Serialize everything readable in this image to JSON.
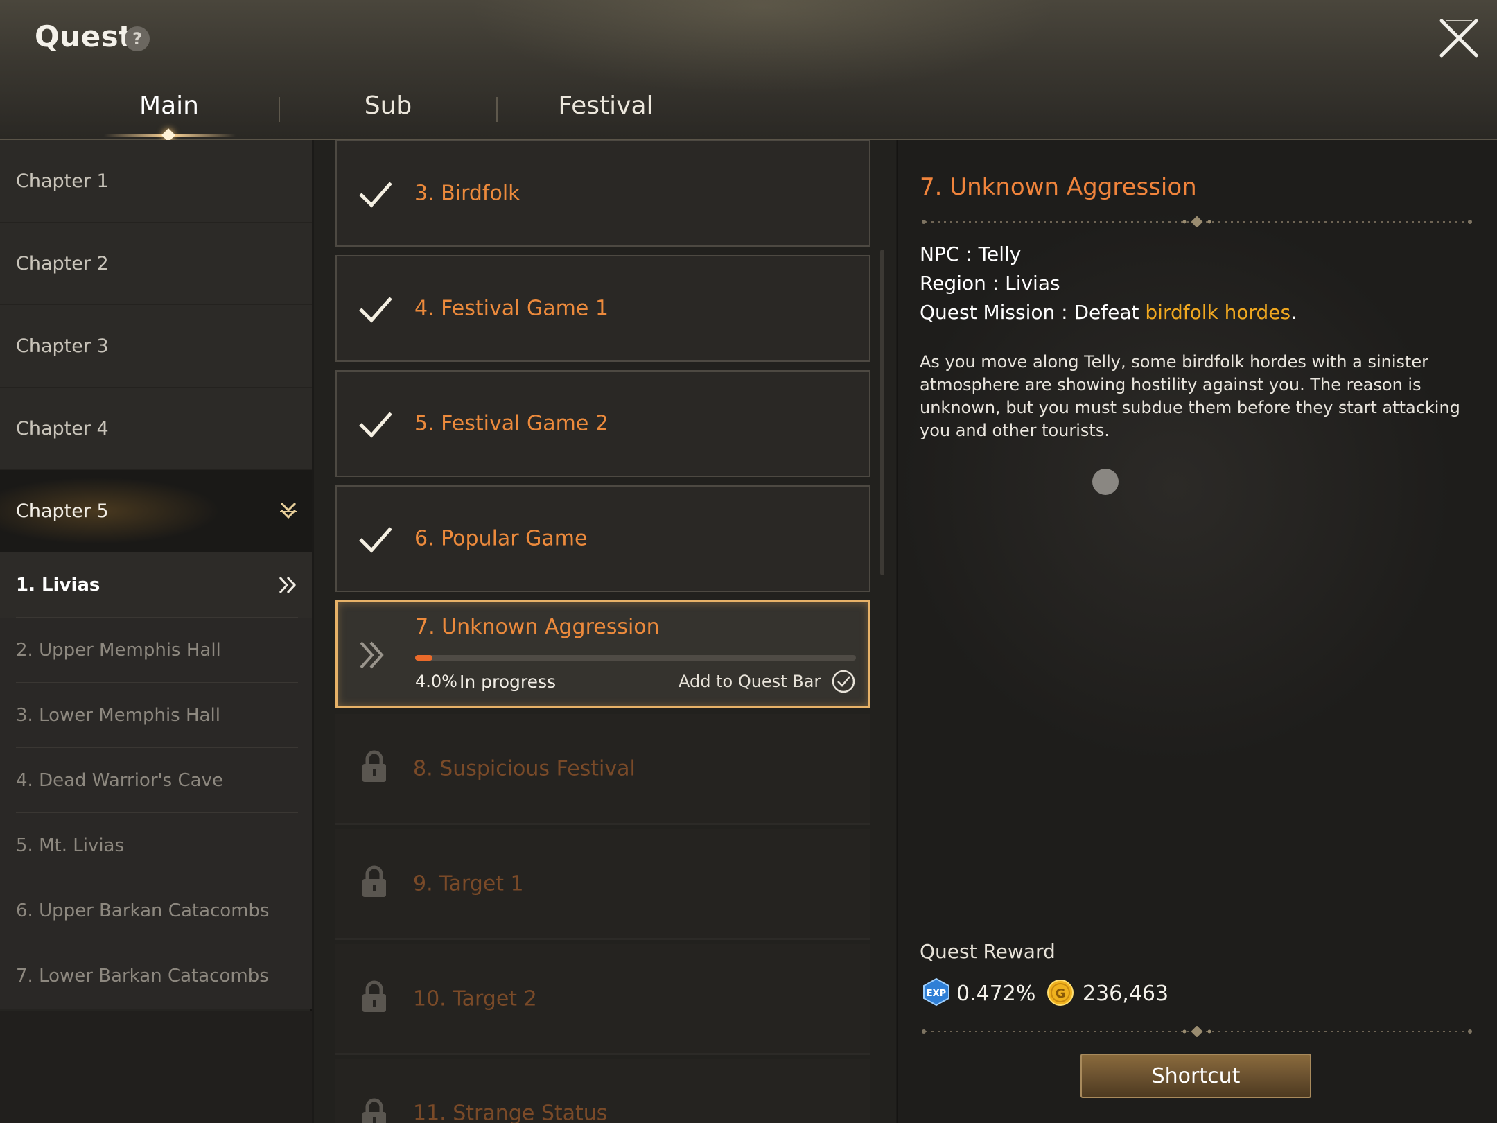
{
  "header": {
    "title": "Quest",
    "help_symbol": "?",
    "tabs": [
      {
        "label": "Main",
        "active": true
      },
      {
        "label": "Sub",
        "active": false
      },
      {
        "label": "Festival",
        "active": false
      }
    ]
  },
  "sidebar": {
    "chapters": [
      {
        "label": "Chapter 1"
      },
      {
        "label": "Chapter 2"
      },
      {
        "label": "Chapter 3"
      },
      {
        "label": "Chapter 4"
      },
      {
        "label": "Chapter 5",
        "expanded": true
      }
    ],
    "sub_items": [
      {
        "label": "1. Livias",
        "active": true
      },
      {
        "label": "2. Upper Memphis Hall"
      },
      {
        "label": "3. Lower Memphis Hall"
      },
      {
        "label": "4. Dead Warrior's Cave"
      },
      {
        "label": "5. Mt. Livias"
      },
      {
        "label": "6. Upper Barkan Catacombs"
      },
      {
        "label": "7. Lower Barkan Catacombs"
      }
    ]
  },
  "quests": {
    "completed": [
      {
        "title": "3. Birdfolk"
      },
      {
        "title": "4. Festival Game 1"
      },
      {
        "title": "5. Festival Game 2"
      },
      {
        "title": "6. Popular Game"
      }
    ],
    "current": {
      "title": "7. Unknown Aggression",
      "progress_pct": 4.0,
      "progress_text": "4.0%",
      "status": "In progress",
      "add_to_bar_label": "Add to Quest Bar"
    },
    "locked": [
      {
        "title": "8. Suspicious Festival"
      },
      {
        "title": "9. Target 1"
      },
      {
        "title": "10. Target 2"
      },
      {
        "title": "11. Strange Status"
      }
    ]
  },
  "detail": {
    "title": "7. Unknown Aggression",
    "npc": "NPC : Telly",
    "region": "Region : Livias",
    "mission_prefix": "Quest Mission : Defeat ",
    "mission_target": "birdfolk hordes",
    "mission_suffix": ".",
    "description": "As you move along Telly, some birdfolk hordes with a sinister atmosphere are showing hostility against you. The reason is unknown, but you must subdue them before they start attacking you and other tourists.",
    "reward_label": "Quest Reward",
    "exp_icon_text": "EXP",
    "exp_value": "0.472%",
    "gold_icon_text": "G",
    "gold_value": "236,463",
    "shortcut_label": "Shortcut"
  },
  "colors": {
    "quest_title": "#ec8a3c",
    "locked_title": "#7a4a28",
    "highlight": "#f0a820",
    "progress_fill": "#ea6a2a",
    "selected_border": "#e7b268"
  }
}
